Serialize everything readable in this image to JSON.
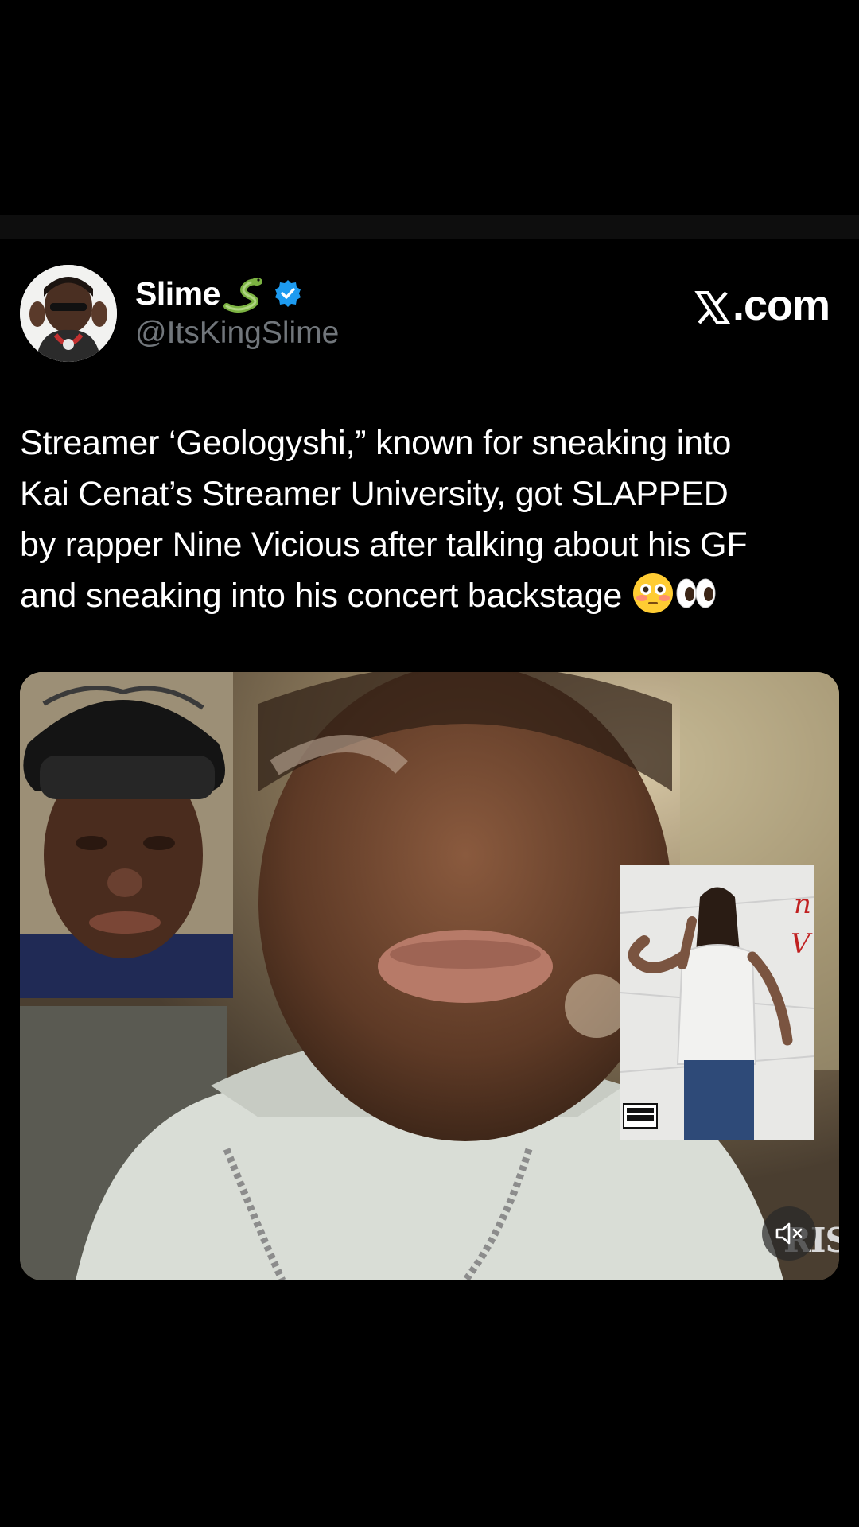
{
  "post": {
    "author": {
      "display_name": "Slime",
      "name_emoji": "snake-emoji",
      "verified_icon": "verified-badge-icon",
      "handle": "@ItsKingSlime",
      "avatar": "avatar"
    },
    "brand": {
      "icon": "x-logo-icon",
      "text": ".com"
    },
    "text": "Streamer ‘Geologyshi,” known for sneaking into\nKai Cenat’s Streamer University, got SLAPPED\nby rapper Nine Vicious after talking about his GF\nand sneaking into his concert backstage ",
    "text_emojis": [
      "flushed-face-emoji",
      "eyes-emoji"
    ],
    "media": {
      "type": "video",
      "mute_icon": "speaker-muted-icon",
      "overlay_text": "RIS"
    }
  },
  "colors": {
    "background": "#000000",
    "text": "#ffffff",
    "secondary_text": "#71767b",
    "verified_blue": "#1d9bf0"
  }
}
